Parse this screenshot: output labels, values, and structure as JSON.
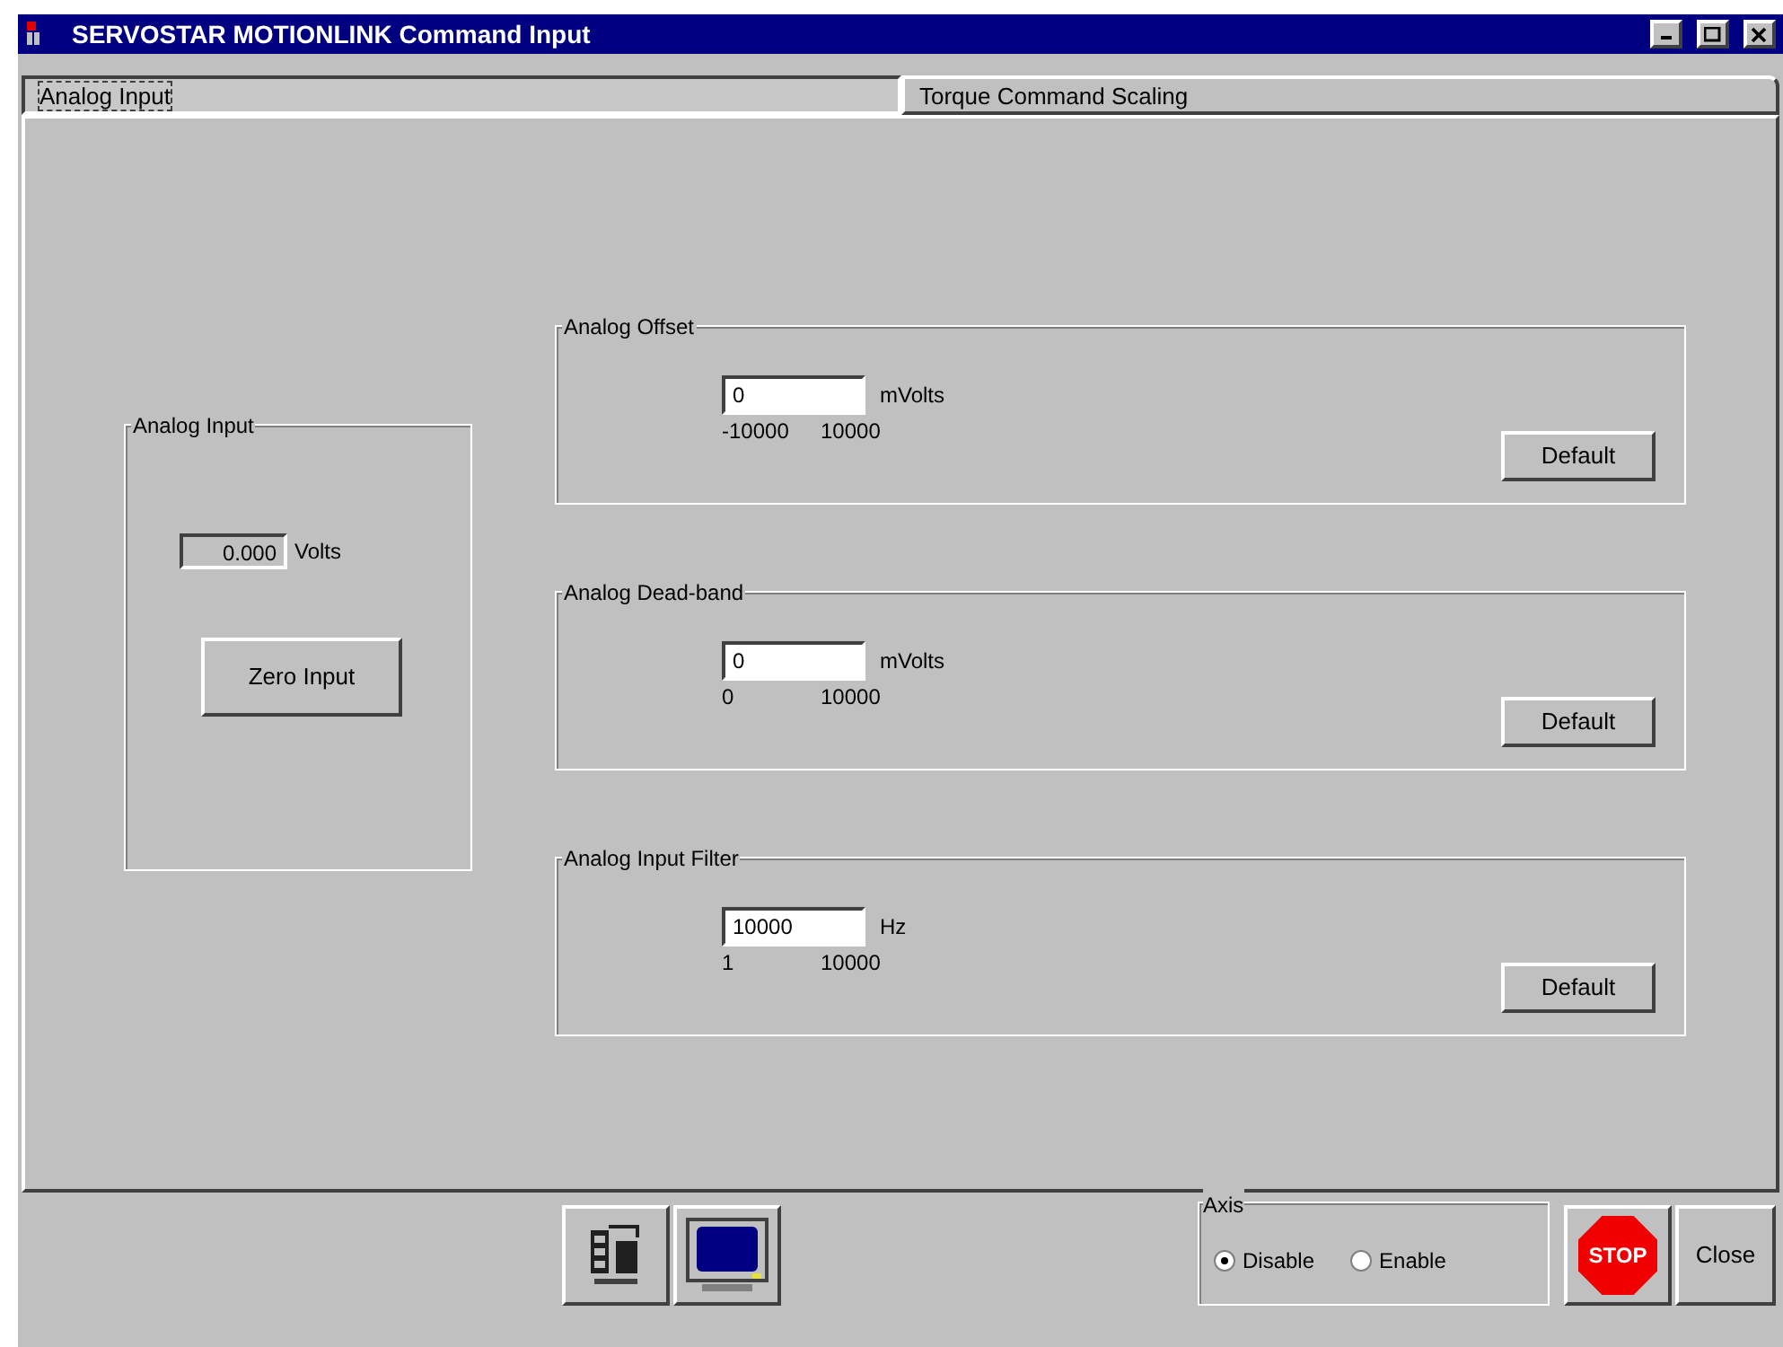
{
  "window": {
    "title": "SERVOSTAR MOTIONLINK Command Input"
  },
  "tabs": [
    {
      "label": "Analog Input",
      "selected": true
    },
    {
      "label": "Torque Command Scaling",
      "selected": false
    }
  ],
  "analog_input": {
    "title": "Analog Input",
    "reading": "0.000",
    "unit": "Volts",
    "button": "Zero Input"
  },
  "groups": [
    {
      "title": "Analog Offset",
      "value": "0",
      "unit": "mVolts",
      "min": "-10000",
      "max": "10000",
      "button": "Default"
    },
    {
      "title": "Analog Dead-band",
      "value": "0",
      "unit": "mVolts",
      "min": "0",
      "max": "10000",
      "button": "Default"
    },
    {
      "title": "Analog Input Filter",
      "value": "10000",
      "unit": "Hz",
      "min": "1",
      "max": "10000",
      "button": "Default"
    }
  ],
  "axis": {
    "title": "Axis",
    "options": [
      {
        "label": "Disable",
        "selected": true
      },
      {
        "label": "Enable",
        "selected": false
      }
    ]
  },
  "stop_button": "STOP",
  "close_button": "Close"
}
